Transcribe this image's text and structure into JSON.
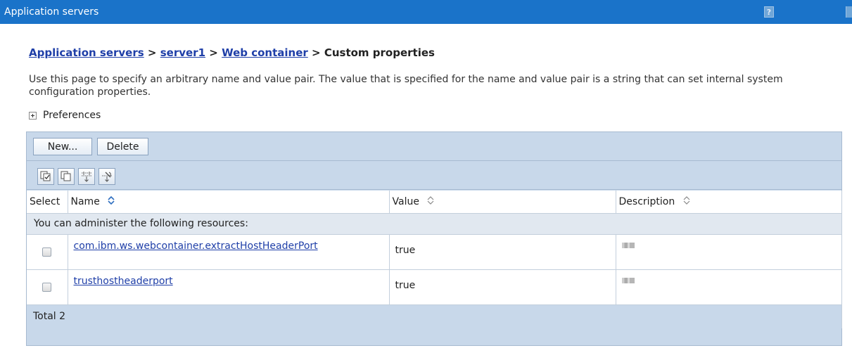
{
  "window": {
    "title": "Application servers",
    "help_label": "?"
  },
  "breadcrumb": {
    "items": [
      "Application servers",
      "server1",
      "Web container"
    ],
    "separator": ">",
    "current": "Custom properties"
  },
  "description": "Use this page to specify an arbitrary name and value pair. The value that is specified for the name and value pair is a string that can set internal system configuration properties.",
  "preferences": {
    "label": "Preferences",
    "icon": "expand-plus-icon"
  },
  "toolbar": {
    "new_label": "New...",
    "delete_label": "Delete",
    "icons": [
      "select-all-icon",
      "deselect-all-icon",
      "show-filter-icon",
      "clear-filter-icon"
    ]
  },
  "table": {
    "columns": {
      "select": "Select",
      "name": "Name",
      "value": "Value",
      "description": "Description"
    },
    "info_row": "You can administer the following resources:",
    "rows": [
      {
        "name": "com.ibm.ws.webcontainer.extractHostHeaderPort",
        "value": "true"
      },
      {
        "name": "trusthostheaderport",
        "value": "true"
      }
    ],
    "total": "Total 2"
  },
  "colors": {
    "titlebar": "#1a73c9",
    "panel": "#c8d8ea",
    "link": "#1f3fa8"
  }
}
